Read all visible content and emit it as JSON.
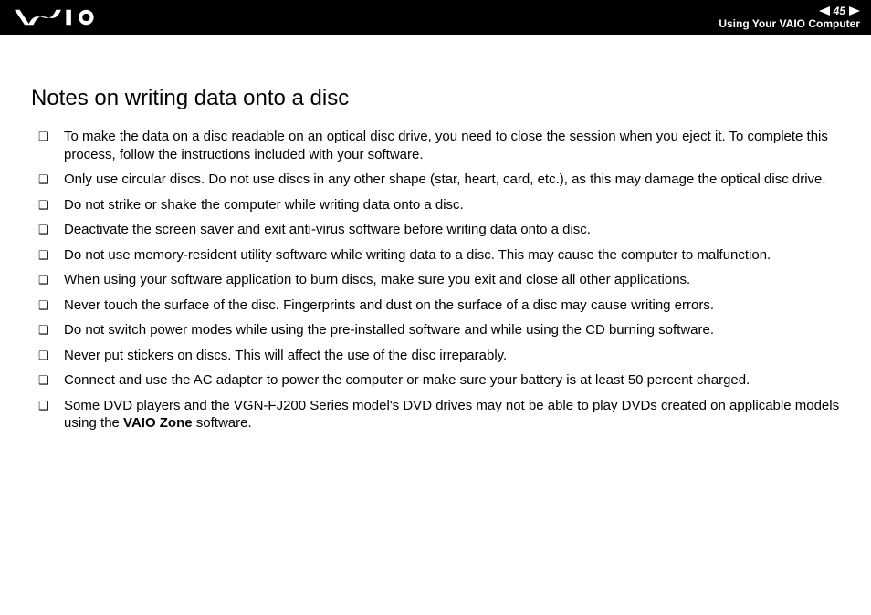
{
  "header": {
    "page_number": "45",
    "section_label": "Using Your VAIO Computer"
  },
  "content": {
    "heading": "Notes on writing data onto a disc",
    "items": [
      "To make the data on a disc readable on an optical disc drive, you need to close the session when you eject it. To complete this process, follow the instructions included with your software.",
      "Only use circular discs. Do not use discs in any other shape (star, heart, card, etc.), as this may damage the optical disc drive.",
      "Do not strike or shake the computer while writing data onto a disc.",
      "Deactivate the screen saver and exit anti-virus software before writing data onto a disc.",
      "Do not use memory-resident utility software while writing data to a disc. This may cause the computer to malfunction.",
      "When using your software application to burn discs, make sure you exit and close all other applications.",
      "Never touch the surface of the disc. Fingerprints and dust on the surface of a disc may cause writing errors.",
      "Do not switch power modes while using the pre-installed software and while using the CD burning software.",
      "Never put stickers on discs. This will affect the use of the disc irreparably.",
      "Connect and use the AC adapter to power the computer or make sure your battery is at least 50 percent charged.",
      "Some DVD players and the VGN-FJ200 Series model's DVD drives may not be able to play DVDs created on applicable models using the <b>VAIO Zone</b> software."
    ]
  }
}
